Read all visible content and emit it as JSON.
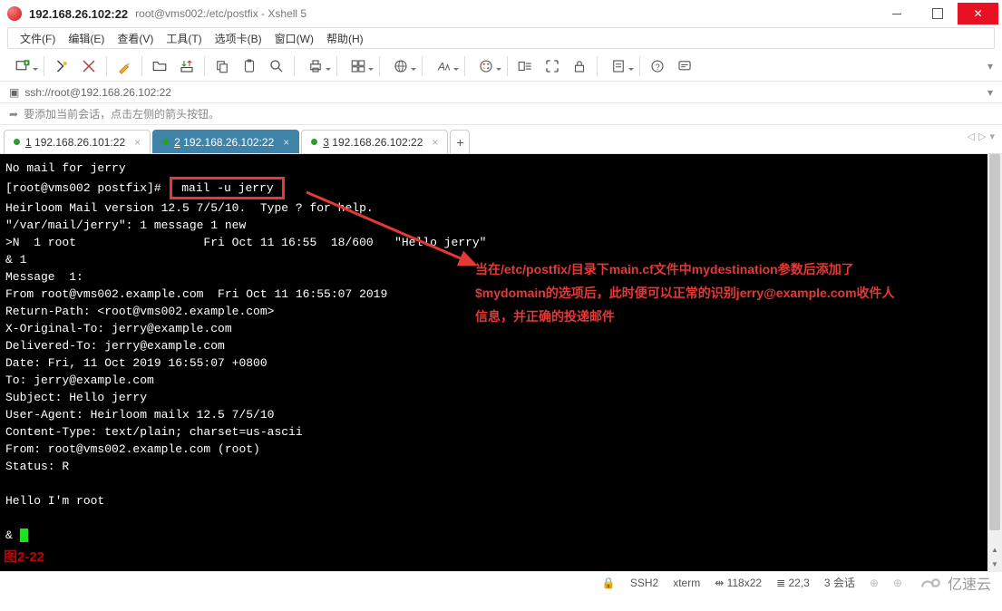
{
  "window": {
    "title_ip": "192.168.26.102:22",
    "title_rest": "root@vms002:/etc/postfix - Xshell 5"
  },
  "menu": {
    "file": "文件(F)",
    "edit": "编辑(E)",
    "view": "查看(V)",
    "tools": "工具(T)",
    "tabs": "选项卡(B)",
    "window": "窗口(W)",
    "help": "帮助(H)"
  },
  "address": {
    "url": "ssh://root@192.168.26.102:22"
  },
  "hint": {
    "text": "要添加当前会话，点击左侧的箭头按钮。"
  },
  "tabs": {
    "t1": {
      "num": "1",
      "label": " 192.168.26.101:22"
    },
    "t2": {
      "num": "2",
      "label": " 192.168.26.102:22"
    },
    "t3": {
      "num": "3",
      "label": " 192.168.26.102:22"
    },
    "add": "+"
  },
  "terminal": {
    "lines": [
      "No mail for jerry",
      "[root@vms002 postfix]#",
      "Heirloom Mail version 12.5 7/5/10.  Type ? for help.",
      "\"/var/mail/jerry\": 1 message 1 new",
      ">N  1 root                  Fri Oct 11 16:55  18/600   \"Hello jerry\"",
      "& 1",
      "Message  1:",
      "From root@vms002.example.com  Fri Oct 11 16:55:07 2019",
      "Return-Path: <root@vms002.example.com>",
      "X-Original-To: jerry@example.com",
      "Delivered-To: jerry@example.com",
      "Date: Fri, 11 Oct 2019 16:55:07 +0800",
      "To: jerry@example.com",
      "Subject: Hello jerry",
      "User-Agent: Heirloom mailx 12.5 7/5/10",
      "Content-Type: text/plain; charset=us-ascii",
      "From: root@vms002.example.com (root)",
      "Status: R",
      "",
      "Hello I'm root",
      "",
      "& "
    ],
    "command_boxed": " mail -u jerry "
  },
  "annotation": {
    "text": "当在/etc/postfix/目录下main.cf文件中mydestination参数后添加了$mydomain的选项后，此时便可以正常的识别jerry@example.com收件人信息，并正确的投递邮件"
  },
  "figure": {
    "label": "图2-22"
  },
  "status": {
    "proto": "SSH2",
    "term": "xterm",
    "size_icon": "⇹",
    "size": "118x22",
    "pos_icon": "≣",
    "pos": "22,3",
    "sessions": "3 会话",
    "brand": "亿速云"
  }
}
